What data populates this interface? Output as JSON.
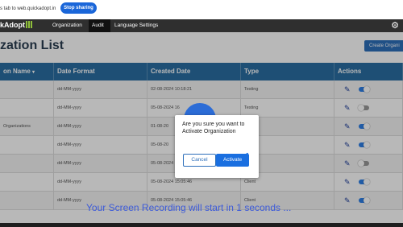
{
  "share_bar": {
    "text": "s tab to web.quickadopt.in",
    "stop_button": "Stop sharing"
  },
  "nav": {
    "logo": "kAdopt",
    "items": [
      "Organization",
      "Audit",
      "Language Settings"
    ],
    "active": "Audit",
    "settings_icon": "gear-icon"
  },
  "page": {
    "title": "zation List",
    "create_button": "Create Organi"
  },
  "table": {
    "columns": [
      "on Name",
      "Date Format",
      "Created Date",
      "Type",
      "Actions"
    ],
    "rows": [
      {
        "name": "",
        "date_format": "dd-MM-yyyy",
        "created": "02-08-2024 10:18:21",
        "type": "Testing",
        "active": true
      },
      {
        "name": "",
        "date_format": "dd-MM-yyyy",
        "created": "05-08-2024 16",
        "type": "Testing",
        "active": false
      },
      {
        "name": "Organizations",
        "date_format": "dd-MM-yyyy",
        "created": "01-08-20",
        "type": "",
        "active": true
      },
      {
        "name": "",
        "date_format": "dd-MM-yyyy",
        "created": "05-08-20",
        "type": "",
        "active": true
      },
      {
        "name": "",
        "date_format": "dd-MM-yyyy",
        "created": "05-08-2024 15:25",
        "type": "",
        "active": false
      },
      {
        "name": "",
        "date_format": "dd-MM-yyyy",
        "created": "05-08-2024 15:05:46",
        "type": "Client",
        "active": true
      },
      {
        "name": "",
        "date_format": "dd-MM-yyyy",
        "created": "05-08-2024 15:05:46",
        "type": "Client",
        "active": true
      }
    ]
  },
  "modal": {
    "message": "Are you sure you want to Activate Organization",
    "cancel": "Cancel",
    "confirm": "Activate"
  },
  "recording_message": "Your Screen Recording will start in 1 seconds ..."
}
